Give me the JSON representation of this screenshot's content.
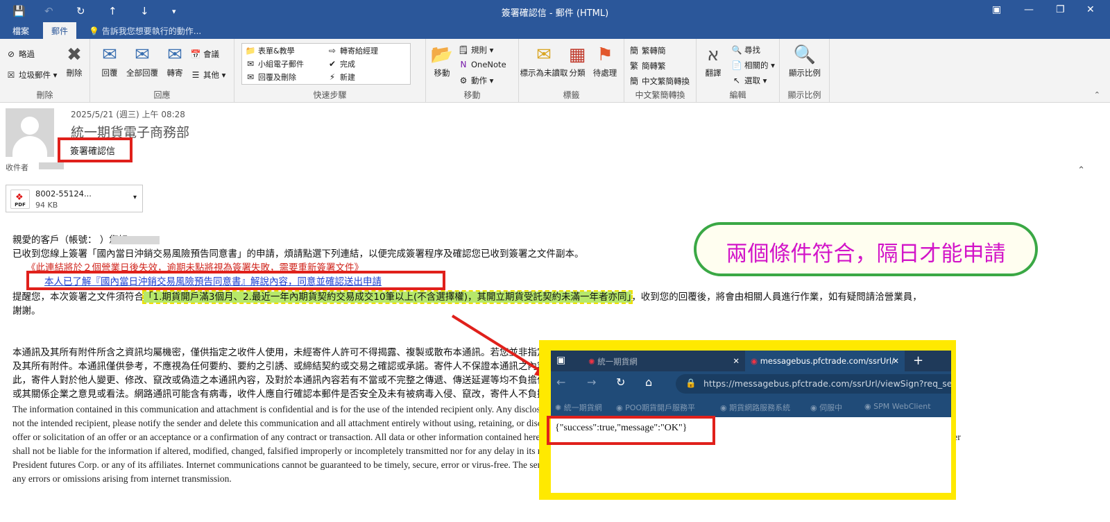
{
  "window": {
    "title": "簽署確認信 - 郵件 (HTML)"
  },
  "ribbon_tabs": {
    "file": "檔案",
    "message": "郵件",
    "tell_me": "告訴我您想要執行的動作..."
  },
  "ribbon": {
    "delete_group": {
      "ignore": "略過",
      "junk": "垃圾郵件",
      "delete": "刪除",
      "label": "刪除"
    },
    "respond_group": {
      "reply": "回覆",
      "reply_all": "全部回覆",
      "forward": "轉寄",
      "meeting": "會議",
      "more": "其他",
      "label": "回應"
    },
    "quick_steps": {
      "items": [
        "表單&教學",
        "轉寄給經理",
        "小組電子郵件",
        "完成",
        "回覆及刪除",
        "新建"
      ],
      "label": "快速步驟"
    },
    "move_group": {
      "move": "移動",
      "rules": "規則",
      "onenote": "OneNote",
      "actions": "動作",
      "label": "移動"
    },
    "tags_group": {
      "unread": "標示為未讀取",
      "categorize": "分類",
      "followup": "待處理",
      "label": "標籤"
    },
    "chinese_group": {
      "to_trad": "繁轉簡",
      "to_simp": "簡轉繁",
      "convert": "中文繁簡轉換",
      "label": "中文繁簡轉換"
    },
    "editing_group": {
      "translate": "翻譯",
      "find": "尋找",
      "related": "相關的",
      "select": "選取",
      "label": "編輯"
    },
    "zoom_group": {
      "zoom": "顯示比例",
      "label": "顯示比例"
    }
  },
  "message": {
    "date": "2025/5/21 (週三) 上午 08:28",
    "sender": "統一期貨電子商務部",
    "subject": "簽署確認信",
    "to_label": "收件者",
    "attachment": {
      "name": "8002-55124...",
      "size": "94 KB",
      "type": "PDF"
    }
  },
  "body": {
    "greeting": "親愛的客戶（帳號：              ）您好：",
    "line1": "已收到您線上簽署「國內當日沖銷交易風險預告同意書」的申請，煩請點選下列連結，以便完成簽署程序及確認您已收到簽署之文件副本。",
    "warning": "《此連結將於２個營業日後失效，逾期未點將視為簽署失敗，需要重新簽署文件》",
    "link": "本人已了解『國內當日沖銷交易風險預告同意書』解說內容，同意並確認送出申請",
    "reminder_pre": "提醒您，本次簽署之文件須符合",
    "reminder_highlight": "「1.期貨開戶滿3個月、2.最近一年內期貨契約交易成交10筆以上(不含選擇權)，其開立期貨受託契約未滿一年者亦同」",
    "reminder_post": "，收到您的回覆後，將會由相關人員進行作業，如有疑問請洽營業員，",
    "thanks": "謝謝。",
    "conf_zh": [
      "本通訊及其所有附件所含之資訊均屬機密，僅供指定之收件人使用，未經寄件人許可不得揭露、複製或散布本通訊。若您並非指定之收件人，請立即通知寄件人且完全刪除本通訊",
      "及其所有附件。本通訊僅供參考，不應視為任何要約、要約之引誘、或締結契約或交易之確認或承諾。寄件人不保證本通訊之內容正確、完整，且寄件人保留修正之權利，得不經通知而變更。因",
      "此，寄件人對於他人變更、修改、竄改或偽造之本通訊內容，及對於本通訊內容若有不當或不完整之傳遞、傳送延遲等均不負擔任何責任。本通訊所表達之任何意見或看法，並不當然反映統一期貨",
      "或其關係企業之意見或看法。網路通訊可能含有病毒，收件人應自行確認本郵件是否安全及未有被病毒入侵、竄改，寄件人不負擔任何責任。"
    ],
    "conf_en": [
      "The information contained in this communication and attachment is confidential and is for the use of the intended recipient only. Any disclosure, copying or distribution of this communication without the sender's consent is strictly prohibited. If you are",
      "not the intended recipient, please notify the sender and delete this communication and all attachment entirely without using, retaining, or disclosing any of its contents. This communication is for reference only and shall not be construed as an",
      "offer or solicitation of an offer or an acceptance or a confirmation of any contract or transaction. All data or other information contained herein is not warranted as to completeness or accuracy and is subject to change without notice. Therefore, the sender",
      "shall not be liable for the information if altered, modified, changed, falsified improperly or incompletely transmitted nor for any delay in its receipt. Any opinions or views expressed in this communication do not necessarily reflect those of",
      "President futures Corp. or any of its affiliates. Internet communications cannot be guaranteed to be timely, secure, error or virus-free. The sender does not accept liability for any errors or omissions which arise. The sender does not accept liability for",
      "any errors or omissions arising from internet transmission."
    ]
  },
  "annotation": {
    "callout": "兩個條件符合，隔日才能申請"
  },
  "browser": {
    "tab1": "統一期貨網",
    "tab2": "messagebus.pfctrade.com/ssrUrl/",
    "url": "https://messagebus.pfctrade.com/ssrUrl/viewSign?req_seq",
    "favorites": [
      "統一期貨網",
      "POO期貨開戶服務平",
      "期貨網路服務系統",
      "伺服中",
      "SPM WebClient"
    ],
    "response": "{\"success\":true,\"message\":\"OK\"}"
  },
  "colors": {
    "accent": "#2b579a",
    "highlight_red": "#e0201b",
    "highlight_yellow": "#ffe900",
    "callout_green": "#3aa845",
    "callout_text": "#d214c8",
    "link_blue": "#1b3fd1",
    "highlight_green": "#b7e86a"
  }
}
